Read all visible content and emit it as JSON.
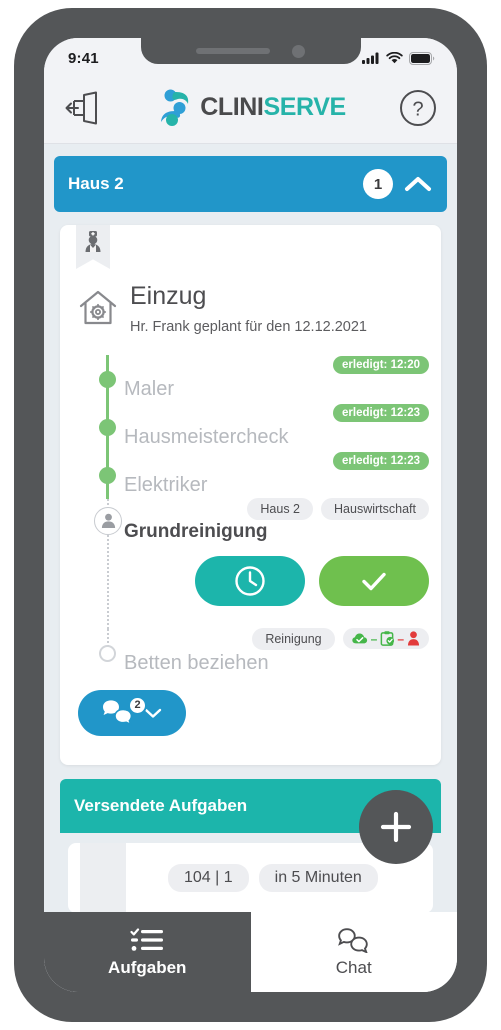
{
  "status_bar": {
    "time": "9:41",
    "icons": [
      "cellular-signal-icon",
      "wifi-icon",
      "battery-icon"
    ]
  },
  "header": {
    "logout_icon": "logout-icon",
    "logo_part1": "CLINI",
    "logo_part2": "SERVE",
    "help_icon": "help-icon"
  },
  "group": {
    "title": "Haus 2",
    "count": "1",
    "collapse_icon": "chevron-up-icon"
  },
  "task_card": {
    "ribbon_icon": "nurse-icon",
    "type_icon": "house-gear-icon",
    "title": "Einzug",
    "subtitle": "Hr. Frank geplant für den 12.12.2021",
    "steps": [
      {
        "label": "Maler",
        "state": "done",
        "badge": "erledigt: 12:20",
        "tags": [],
        "status_icons": []
      },
      {
        "label": "Hausmeistercheck",
        "state": "done",
        "badge": "erledigt: 12:23",
        "tags": [],
        "status_icons": []
      },
      {
        "label": "Elektriker",
        "state": "done",
        "badge": "erledigt: 12:23",
        "tags": [],
        "status_icons": []
      },
      {
        "label": "Grundreinigung",
        "state": "active",
        "badge": "",
        "tags": [
          "Haus 2",
          "Hauswirtschaft"
        ],
        "status_icons": []
      },
      {
        "label": "Betten beziehen",
        "state": "open",
        "badge": "",
        "tags": [
          "Reinigung"
        ],
        "status_icons": [
          "cloud-check-icon",
          "clipboard-check-icon",
          "person-icon"
        ]
      }
    ],
    "actions": {
      "snooze_icon": "clock-icon",
      "confirm_icon": "check-icon"
    },
    "chat": {
      "icon": "chat-bubbles-icon",
      "badge": "2",
      "expand_icon": "chevron-down-icon"
    }
  },
  "sent_section": {
    "title": "Versendete Aufgaben",
    "chips": [
      "104 | 1",
      "in 5 Minuten"
    ]
  },
  "fab": {
    "icon": "plus-icon"
  },
  "bottom_nav": {
    "items": [
      {
        "label": "Aufgaben",
        "icon": "checklist-icon",
        "active": true
      },
      {
        "label": "Chat",
        "icon": "chat-icon",
        "active": false
      }
    ]
  },
  "colors": {
    "blue": "#2196c9",
    "teal": "#1cb5ab",
    "green": "#7cc576",
    "confirm_green": "#6fc04e",
    "dark_gray": "#545658",
    "red": "#e23b3b"
  }
}
